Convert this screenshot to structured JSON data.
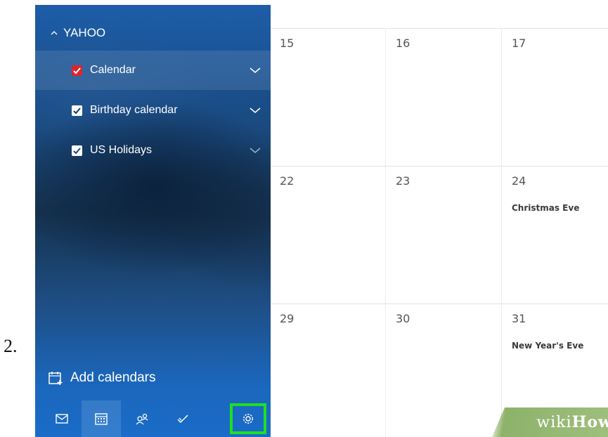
{
  "step": {
    "number": "2."
  },
  "sidebar": {
    "account": "YAHOO",
    "calendars": [
      {
        "label": "Calendar",
        "checked": true,
        "color": "#d9262e"
      },
      {
        "label": "Birthday calendar",
        "checked": true,
        "color": "#ffffff"
      },
      {
        "label": "US Holidays",
        "checked": true,
        "color": "#ffffff"
      }
    ],
    "add_calendars": "Add calendars",
    "bottom_icons": [
      "mail-icon",
      "calendar-icon",
      "people-icon",
      "todo-icon",
      "gear-icon"
    ]
  },
  "calendar": {
    "weeks": [
      {
        "days": [
          "15",
          "16",
          "17"
        ],
        "events": [
          "",
          "",
          ""
        ]
      },
      {
        "days": [
          "22",
          "23",
          "24"
        ],
        "events": [
          "",
          "",
          "Christmas Eve"
        ]
      },
      {
        "days": [
          "29",
          "30",
          "31"
        ],
        "events": [
          "",
          "",
          "New Year's Eve"
        ]
      }
    ]
  },
  "watermark": {
    "part1": "wiki",
    "part2": "How"
  },
  "colors": {
    "highlight": "#1fe01f",
    "sidebar_blue": "#1b67bd"
  }
}
